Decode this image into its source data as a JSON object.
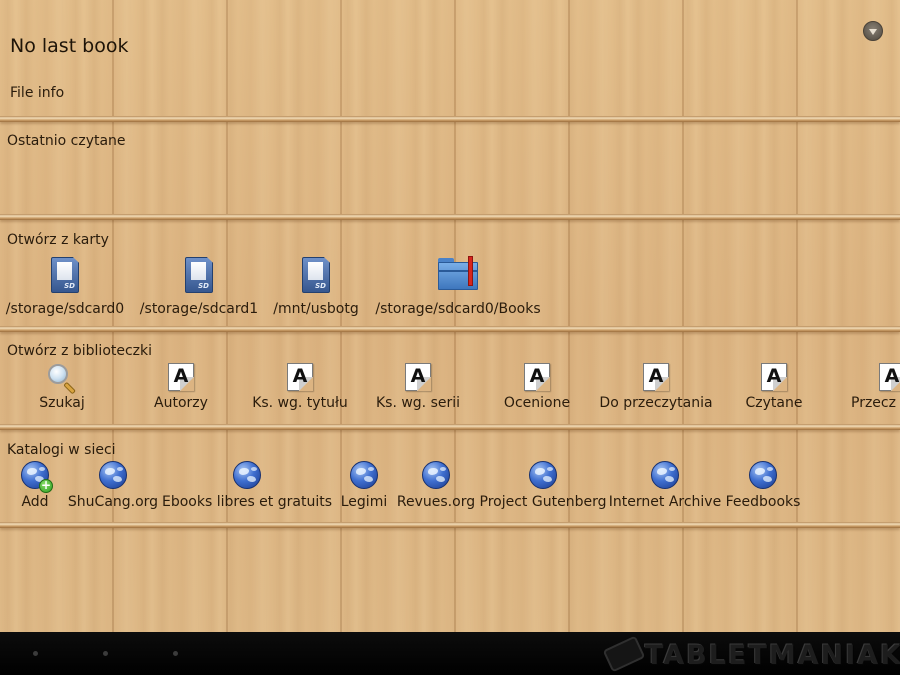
{
  "header": {
    "title": "No last book",
    "file_info_label": "File info"
  },
  "sections": {
    "recent": {
      "title": "Ostatnio czytane"
    },
    "open_from_card": {
      "title": "Otwórz z karty",
      "items": [
        {
          "label": "/storage/sdcard0",
          "icon": "sd-card-icon"
        },
        {
          "label": "/storage/sdcard1",
          "icon": "sd-card-icon"
        },
        {
          "label": "/mnt/usbotg",
          "icon": "sd-card-icon"
        },
        {
          "label": "/storage/sdcard0/Books",
          "icon": "folder-icon"
        }
      ]
    },
    "library": {
      "title": "Otwórz z biblioteczki",
      "items": [
        {
          "label": "Szukaj",
          "icon": "search-icon"
        },
        {
          "label": "Autorzy",
          "icon": "document-a-icon"
        },
        {
          "label": "Ks. wg. tytułu",
          "icon": "document-a-icon"
        },
        {
          "label": "Ks. wg. serii",
          "icon": "document-a-icon"
        },
        {
          "label": "Ocenione",
          "icon": "document-a-icon"
        },
        {
          "label": "Do przeczytania",
          "icon": "document-a-icon"
        },
        {
          "label": "Czytane",
          "icon": "document-a-icon"
        },
        {
          "label": "Przecz",
          "icon": "document-a-icon"
        }
      ]
    },
    "catalogs": {
      "title": "Katalogi w sieci",
      "items": [
        {
          "label": "Add",
          "icon": "globe-add-icon"
        },
        {
          "label": "ShuCang.org",
          "icon": "globe-icon"
        },
        {
          "label": "Ebooks libres et gratuits",
          "icon": "globe-icon"
        },
        {
          "label": "Legimi",
          "icon": "globe-icon"
        },
        {
          "label": "Revues.org",
          "icon": "globe-icon"
        },
        {
          "label": "Project Gutenberg",
          "icon": "globe-icon"
        },
        {
          "label": "Internet Archive",
          "icon": "globe-icon"
        },
        {
          "label": "Feedbooks",
          "icon": "globe-icon"
        }
      ]
    }
  },
  "watermark": "TABLETMANIAK",
  "colors": {
    "wood": "#dcb482",
    "text": "#2a1c0c",
    "navbar": "#000000"
  }
}
